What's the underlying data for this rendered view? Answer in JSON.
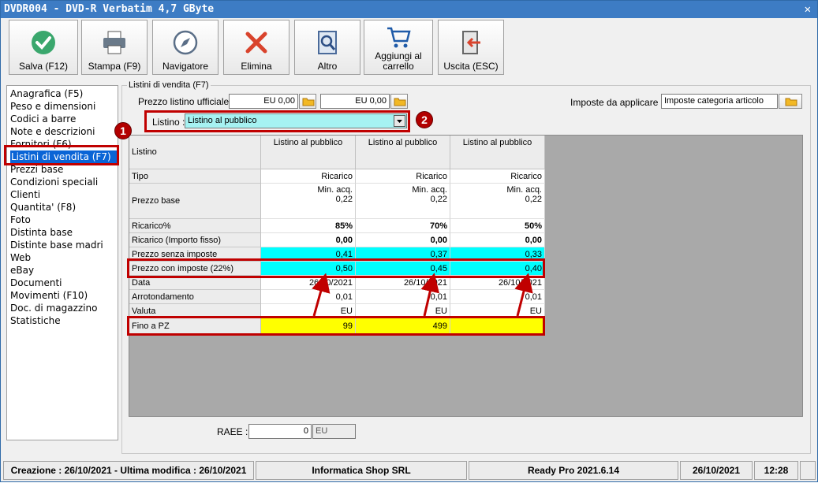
{
  "window": {
    "title": "DVDR004 - DVD-R Verbatim 4,7 GByte",
    "close": "✕"
  },
  "toolbar": {
    "save": "Salva (F12)",
    "print": "Stampa (F9)",
    "navigator": "Navigatore",
    "delete": "Elimina",
    "other": "Altro",
    "add_cart_1": "Aggiungi al",
    "add_cart_2": "carrello",
    "exit": "Uscita (ESC)"
  },
  "sidebar": {
    "items": [
      "Anagrafica (F5)",
      "Peso e dimensioni",
      "Codici a barre",
      "Note e descrizioni",
      "Fornitori (F6)",
      "Listini di vendita (F7)",
      "Prezzi base",
      "Condizioni speciali",
      "Clienti",
      "Quantita' (F8)",
      "Foto",
      "Distinta base",
      "Distinte base madri",
      "Web",
      "eBay",
      "Documenti",
      "Movimenti (F10)",
      "Doc. di magazzino",
      "Statistiche"
    ],
    "selected": 5
  },
  "panel": {
    "title": "Listini di vendita (F7)",
    "official_price_label": "Prezzo listino ufficiale :",
    "official_price_1": "EU 0,00",
    "official_price_2": "EU 0,00",
    "taxes_label": "Imposte da applicare :",
    "taxes_value": "Imposte categoria articolo",
    "listino_label": "Listino :",
    "listino_value": "Listino al pubblico"
  },
  "grid": {
    "corner": "Listino",
    "columns": [
      "Listino al pubblico",
      "Listino al pubblico",
      "Listino al pubblico"
    ],
    "rows": [
      {
        "label": "Tipo",
        "values": [
          "Ricarico",
          "Ricarico",
          "Ricarico"
        ]
      },
      {
        "label": "Prezzo base",
        "values": [
          "Min. acq.\n0,22",
          "Min. acq.\n0,22",
          "Min. acq.\n0,22"
        ]
      },
      {
        "label": "Ricarico%",
        "values": [
          "85%",
          "70%",
          "50%"
        ]
      },
      {
        "label": "Ricarico (Importo fisso)",
        "values": [
          "0,00",
          "0,00",
          "0,00"
        ]
      },
      {
        "label": "Prezzo senza imposte",
        "values": [
          "0,41",
          "0,37",
          "0,33"
        ]
      },
      {
        "label": "Prezzo con imposte (22%)",
        "values": [
          "0,50",
          "0,45",
          "0,40"
        ]
      },
      {
        "label": "Data",
        "values": [
          "26/10/2021",
          "26/10/2021",
          "26/10/2021"
        ]
      },
      {
        "label": "Arrotondamento",
        "values": [
          "0,01",
          "0,01",
          "0,01"
        ]
      },
      {
        "label": "Valuta",
        "values": [
          "EU",
          "EU",
          "EU"
        ]
      },
      {
        "label": "Fino a PZ",
        "values": [
          "99",
          "499",
          ""
        ]
      }
    ]
  },
  "raee": {
    "label": "RAEE :",
    "value": "0",
    "unit": "EU"
  },
  "badges": [
    "1",
    "2"
  ],
  "status": {
    "created": "Creazione : 26/10/2021 - Ultima modifica : 26/10/2021",
    "company": "Informatica Shop SRL",
    "version": "Ready Pro 2021.6.14",
    "date": "26/10/2021",
    "time": "12:28"
  },
  "colors": {
    "accent": "#0a64d6",
    "title": "#3d7cc4",
    "highlight_cyan": "#00ffff",
    "highlight_yellow": "#ffff00",
    "annotation": "#c00000"
  }
}
